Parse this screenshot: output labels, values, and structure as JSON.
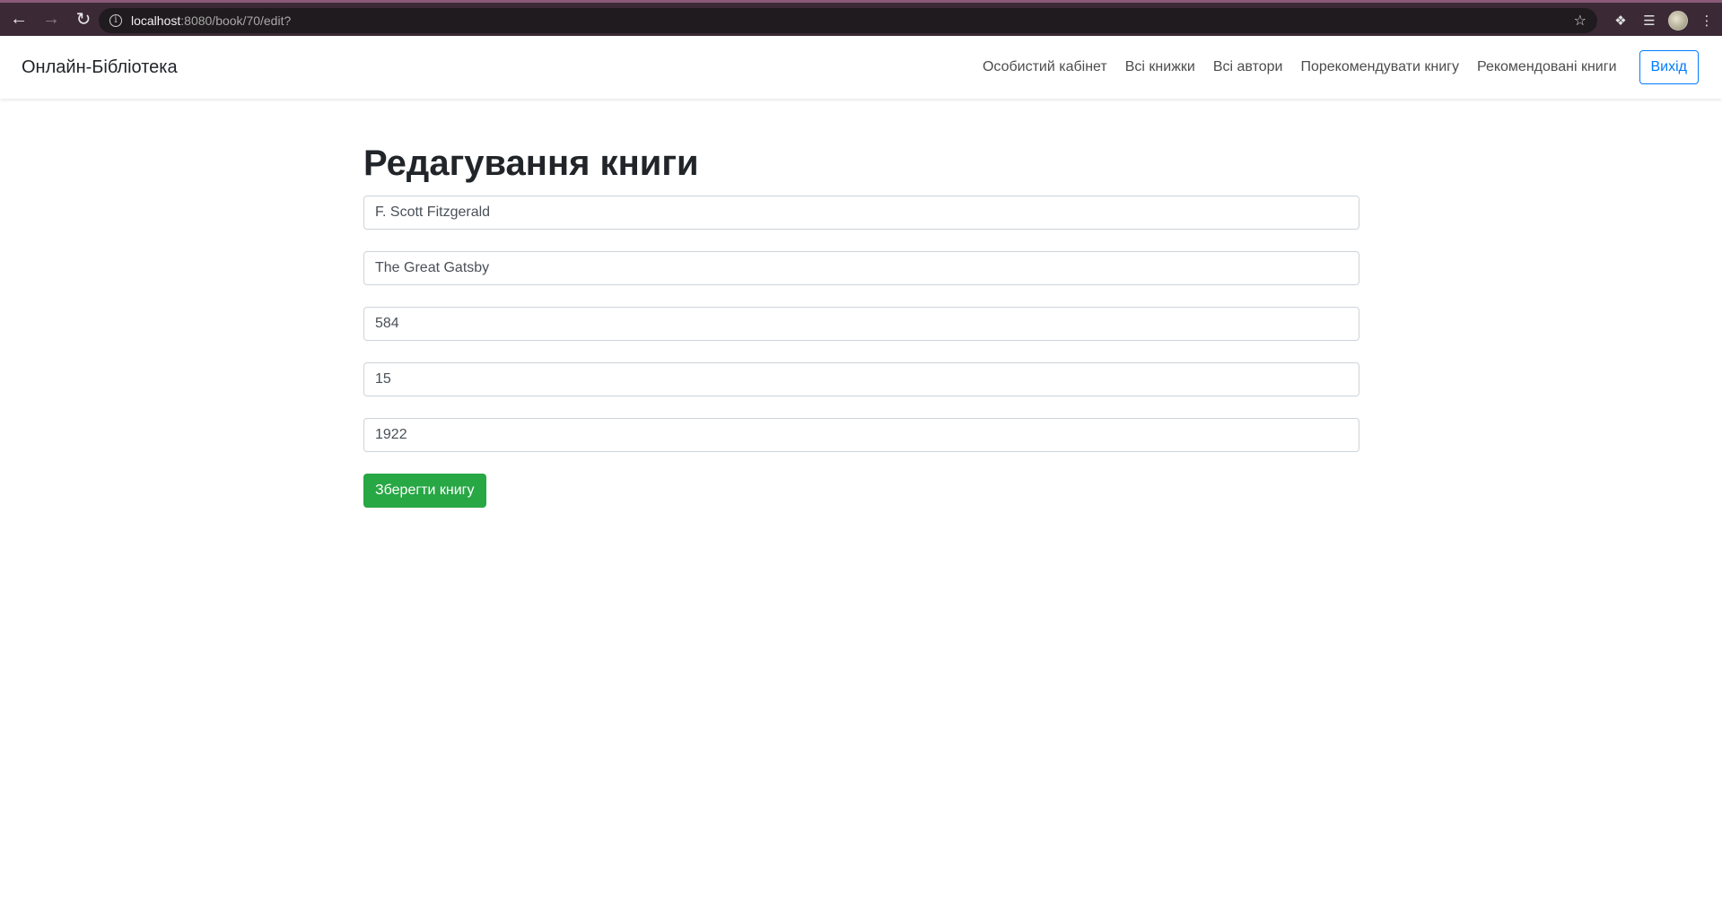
{
  "browser": {
    "url_host": "localhost",
    "url_rest": ":8080/book/70/edit?"
  },
  "navbar": {
    "brand": "Онлайн-Бібліотека",
    "links": [
      "Особистий кабінет",
      "Всі книжки",
      "Всі автори",
      "Порекомендувати книгу",
      "Рекомендовані книги"
    ],
    "logout_label": "Вихід",
    "accent_color": "#007bff"
  },
  "main": {
    "title": "Редагування книги",
    "fields": {
      "author": "F. Scott Fitzgerald",
      "title": "The Great Gatsby",
      "pages": "584",
      "quantity": "15",
      "year": "1922"
    },
    "save_label": "Зберегти книгу",
    "save_color": "#28a745"
  }
}
